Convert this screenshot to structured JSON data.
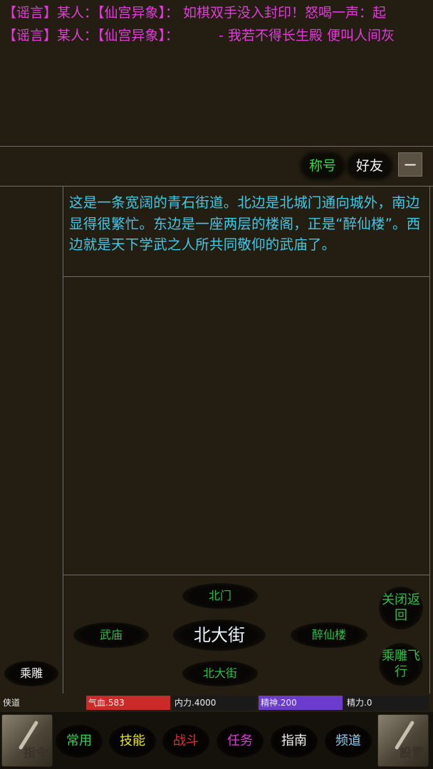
{
  "rumors": [
    {
      "tag": "【谣言】",
      "speaker": "某人：",
      "source": "【仙宫异象】：",
      "message": "如棋双手没入封印！怒喝一声：起"
    },
    {
      "tag": "【谣言】",
      "speaker": "某人：",
      "source": "【仙宫异象】：",
      "message": "- 我若不得长生殿 便叫人间灰"
    }
  ],
  "tabs": {
    "title": "称号",
    "friends": "好友",
    "collapse": "−"
  },
  "description": "这是一条宽阔的青石街道。北边是北城门通向城外，南边显得很繁忙。东边是一座两层的楼阁，正是“醉仙楼”。西边就是天下学武之人所共同敬仰的武庙了。",
  "exits": {
    "north": "北门",
    "west": "武庙",
    "current": "北大街",
    "east": "醉仙楼",
    "south": "北大街"
  },
  "side_actions": {
    "close": "关闭返回",
    "fly": "乘雕飞行"
  },
  "ride_button": "乘雕",
  "status": {
    "name": "侠道",
    "hp": {
      "label": "气血.583",
      "fraction": 1.0,
      "color": "#cc2a2a"
    },
    "neili": {
      "label": "内力.4000",
      "fraction": 0.0,
      "color": "#cc2a2a"
    },
    "jingshen": {
      "label": "精神.200",
      "fraction": 1.0,
      "color": "#6b3ccf"
    },
    "jingli": {
      "label": "精力.0",
      "fraction": 0.0,
      "color": "#2f7fd0"
    }
  },
  "menu": {
    "left_corner": "指令",
    "right_corner": "設置",
    "items": [
      {
        "label": "常用",
        "color": "#38d04e"
      },
      {
        "label": "技能",
        "color": "#e6e62a"
      },
      {
        "label": "战斗",
        "color": "#e03030"
      },
      {
        "label": "任务",
        "color": "#e03cd8"
      },
      {
        "label": "指南",
        "color": "#f2f2f2"
      },
      {
        "label": "频道",
        "color": "#8fd0f0"
      }
    ]
  }
}
